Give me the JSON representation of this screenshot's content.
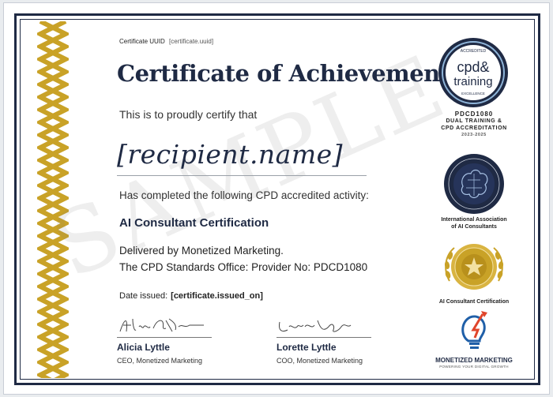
{
  "certificate": {
    "uuid_label": "Certificate UUID",
    "uuid_value": "[certificate.uuid]",
    "title": "Certificate of Achievement",
    "certify_text": "This is to proudly certify that",
    "recipient": "[recipient.name]",
    "completed_text": "Has completed the following CPD accredited activity:",
    "course_name": "AI Consultant Certification",
    "delivered_by": "Delivered by Monetized Marketing.",
    "provider_line": "The CPD Standards Office: Provider No: PDCD1080",
    "issued_label": "Date issued:",
    "issued_value": "[certificate.issued_on]",
    "watermark": "SAMPLE"
  },
  "signatories": [
    {
      "name": "Alicia Lyttle",
      "role": "CEO, Monetized Marketing"
    },
    {
      "name": "Lorette Lyttle",
      "role": "COO, Monetized Marketing"
    }
  ],
  "badges": {
    "cpd": {
      "top_text": "ACCREDITED",
      "line1": "cpd&",
      "line2": "training",
      "bottom_text": "EXCELLENCE",
      "caption_1": "PDCD1080",
      "caption_2": "DUAL TRAINING &",
      "caption_3": "CPD ACCREDITATION",
      "caption_year": "2023-2025"
    },
    "iaaic": {
      "caption_1": "International Association",
      "caption_2": "of AI Consultants"
    },
    "gold": {
      "caption": "AI Consultant Certification"
    },
    "monetized": {
      "name": "MONETIZED MARKETING",
      "tagline": "POWERING YOUR DIGITAL GROWTH"
    }
  },
  "colors": {
    "navy": "#1f2a44",
    "gold": "#c9a227",
    "frame": "#1f2a44"
  }
}
